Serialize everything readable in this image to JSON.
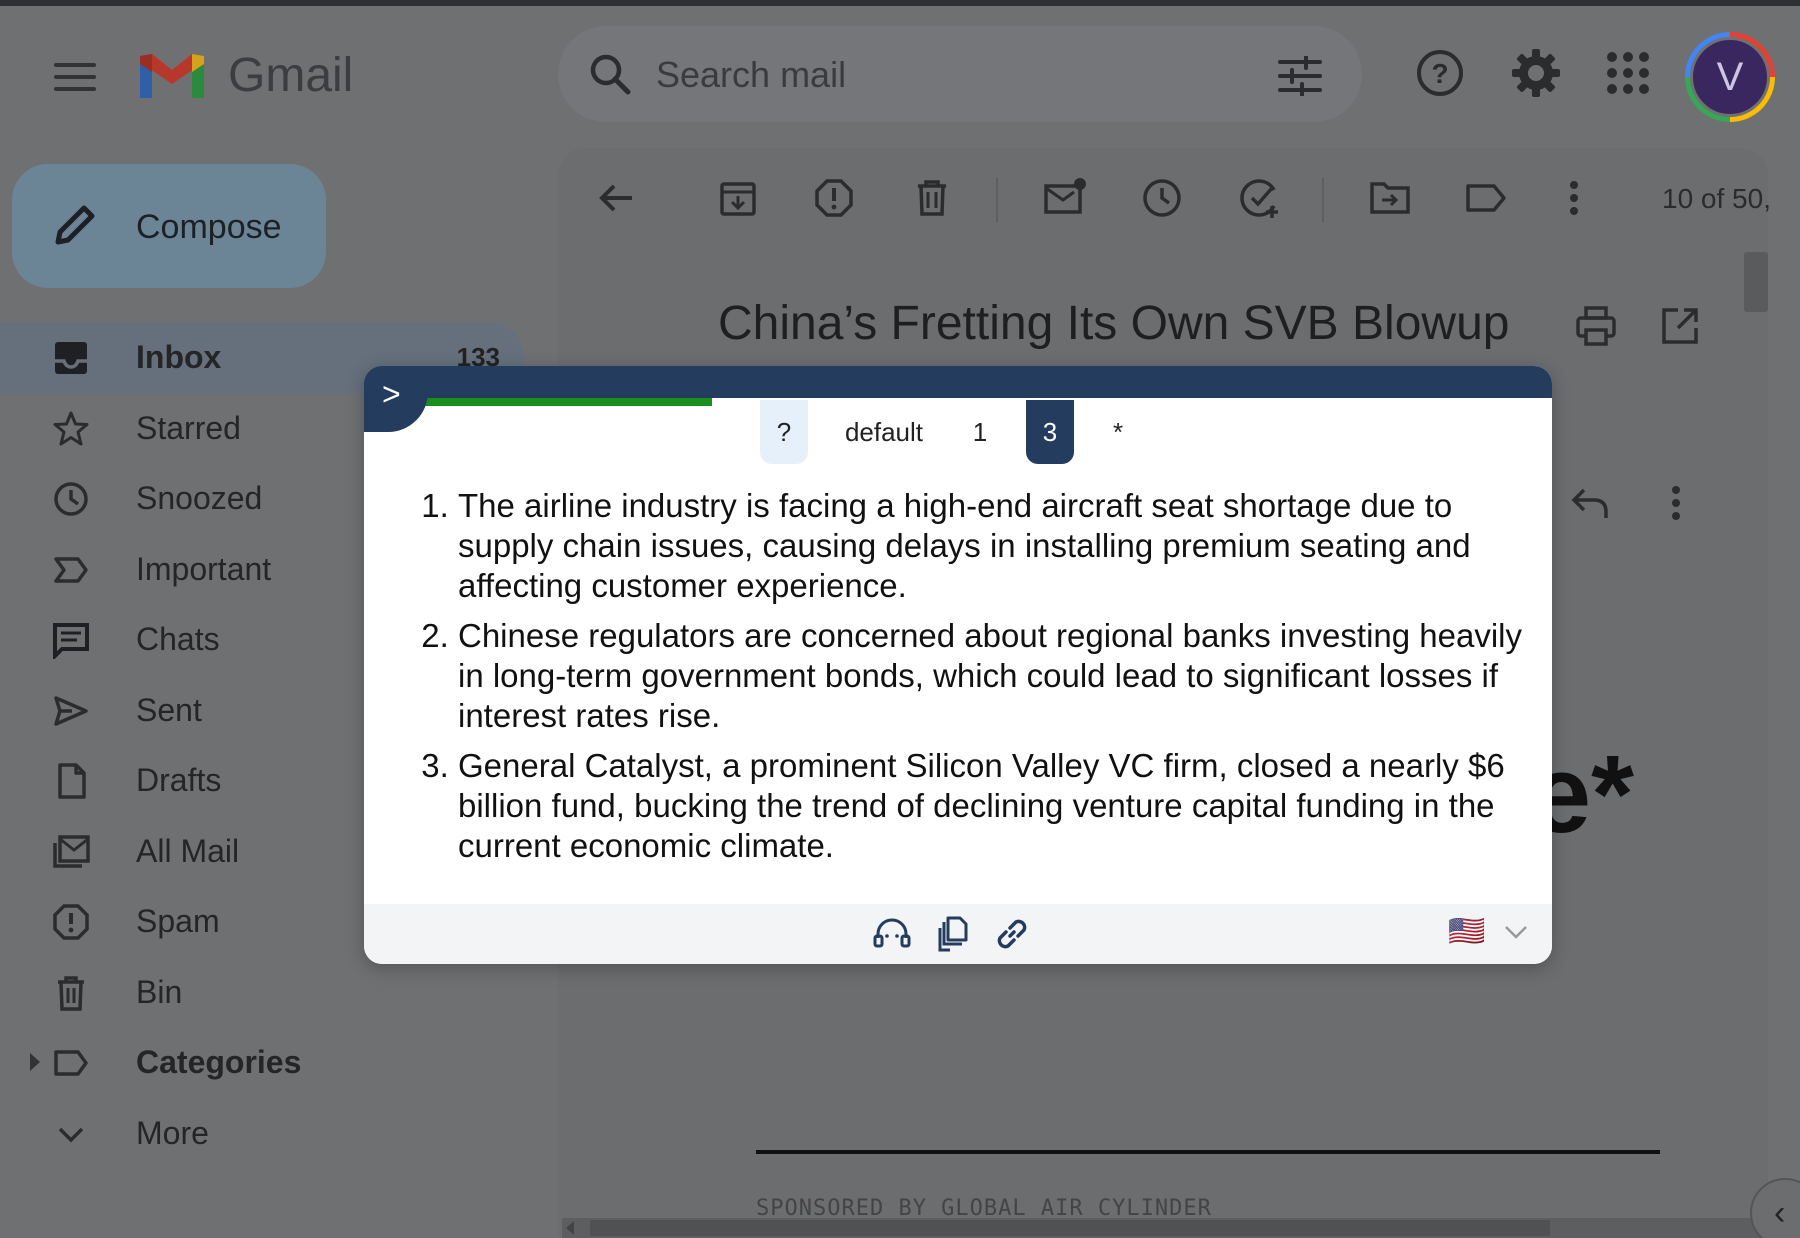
{
  "app": {
    "brand": "Gmail",
    "avatar_initial": "V"
  },
  "search": {
    "placeholder": "Search mail"
  },
  "compose": {
    "label": "Compose"
  },
  "sidebar": {
    "items": [
      {
        "label": "Inbox",
        "count": "133",
        "icon": "inbox-icon"
      },
      {
        "label": "Starred",
        "icon": "star-icon"
      },
      {
        "label": "Snoozed",
        "icon": "clock-icon"
      },
      {
        "label": "Important",
        "icon": "important-icon"
      },
      {
        "label": "Chats",
        "icon": "chat-icon"
      },
      {
        "label": "Sent",
        "icon": "send-icon"
      },
      {
        "label": "Drafts",
        "icon": "draft-icon"
      },
      {
        "label": "All Mail",
        "icon": "all-mail-icon"
      },
      {
        "label": "Spam",
        "icon": "spam-icon"
      },
      {
        "label": "Bin",
        "icon": "bin-icon"
      },
      {
        "label": "Categories",
        "icon": "label-icon"
      },
      {
        "label": "More",
        "icon": "chevron-down-icon"
      }
    ]
  },
  "toolbar": {
    "page_count": "10 of 50,"
  },
  "email": {
    "subject": "China’s Fretting Its Own SVB Blowup",
    "partial_glyph": "e*",
    "sponsor_text": "SPONSORED BY GLOBAL AIR CYLINDER"
  },
  "popup": {
    "tabs": [
      {
        "label": "?"
      },
      {
        "label": "default"
      },
      {
        "label": "1"
      },
      {
        "label": "3",
        "active": true
      },
      {
        "label": "*"
      }
    ],
    "summary": [
      "The airline industry is facing a high-end aircraft seat shortage due to supply chain issues, causing delays in installing premium seating and affecting customer experience.",
      "Chinese regulators are concerned about regional banks investing heavily in long-term government bonds, which could lead to significant losses if interest rates rise.",
      "General Catalyst, a prominent Silicon Valley VC firm, closed a nearly $6 billion fund, bucking the trend of declining venture capital funding in the current economic climate."
    ],
    "language_flag": "🇺🇸",
    "colors": {
      "header": "#243c5e",
      "progress": "#1b8f1d"
    }
  }
}
